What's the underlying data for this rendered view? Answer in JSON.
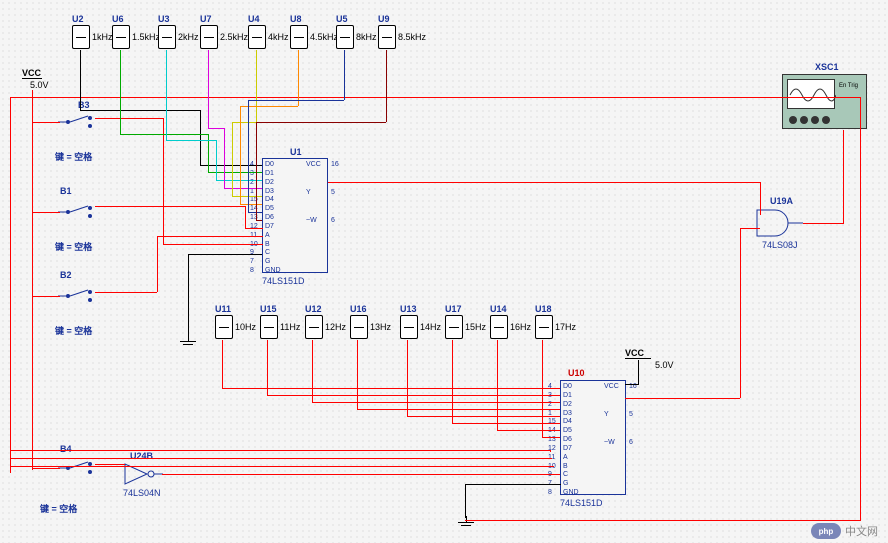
{
  "power": {
    "vcc1_label": "VCC",
    "vcc1_val": "5.0V",
    "vcc2_label": "VCC",
    "vcc2_val": "5.0V"
  },
  "sources_top": [
    {
      "ref": "U2",
      "freq": "1kHz"
    },
    {
      "ref": "U6",
      "freq": "1.5kHz"
    },
    {
      "ref": "U3",
      "freq": "2kHz"
    },
    {
      "ref": "U7",
      "freq": "2.5kHz"
    },
    {
      "ref": "U4",
      "freq": "4kHz"
    },
    {
      "ref": "U8",
      "freq": "4.5kHz"
    },
    {
      "ref": "U5",
      "freq": "8kHz"
    },
    {
      "ref": "U9",
      "freq": "8.5kHz"
    }
  ],
  "sources_bot": [
    {
      "ref": "U11",
      "freq": "10Hz"
    },
    {
      "ref": "U15",
      "freq": "11Hz"
    },
    {
      "ref": "U12",
      "freq": "12Hz"
    },
    {
      "ref": "U16",
      "freq": "13Hz"
    },
    {
      "ref": "U13",
      "freq": "14Hz"
    },
    {
      "ref": "U17",
      "freq": "15Hz"
    },
    {
      "ref": "U14",
      "freq": "16Hz"
    },
    {
      "ref": "U18",
      "freq": "17Hz"
    }
  ],
  "mux1": {
    "ref": "U1",
    "part": "74LS151D",
    "pins_left": [
      "D0",
      "D1",
      "D2",
      "D3",
      "D4",
      "D5",
      "D6",
      "D7",
      "A",
      "B",
      "C",
      "G",
      "GND"
    ],
    "pins_right": [
      "VCC",
      "",
      "Y",
      "",
      "~W",
      ""
    ],
    "nums_left": [
      "4",
      "3",
      "2",
      "1",
      "15",
      "14",
      "13",
      "12",
      "11",
      "10",
      "9",
      "7",
      "8"
    ],
    "nums_right": [
      "16",
      "",
      "5",
      "",
      "6",
      ""
    ]
  },
  "mux2": {
    "ref": "U10",
    "part": "74LS151D",
    "pins_left": [
      "D0",
      "D1",
      "D2",
      "D3",
      "D4",
      "D5",
      "D6",
      "D7",
      "A",
      "B",
      "C",
      "G",
      "GND"
    ],
    "pins_right": [
      "VCC",
      "",
      "Y",
      "",
      "~W",
      ""
    ],
    "nums_left": [
      "4",
      "3",
      "2",
      "1",
      "15",
      "14",
      "13",
      "12",
      "11",
      "10",
      "9",
      "7",
      "8"
    ],
    "nums_right": [
      "16",
      "",
      "5",
      "",
      "6",
      ""
    ]
  },
  "and_gate": {
    "ref": "U19A",
    "part": "74LS08J"
  },
  "inverter": {
    "ref": "U24B",
    "part": "74LS04N"
  },
  "switches": {
    "b3": {
      "ref": "B3",
      "hint": "键 = 空格"
    },
    "b1": {
      "ref": "B1",
      "hint": "键 = 空格"
    },
    "b2": {
      "ref": "B2",
      "hint": "键 = 空格"
    },
    "b4": {
      "ref": "B4",
      "hint": "键 = 空格"
    }
  },
  "scope": {
    "ref": "XSC1",
    "btn": "En Trig"
  },
  "watermark": "中文网"
}
